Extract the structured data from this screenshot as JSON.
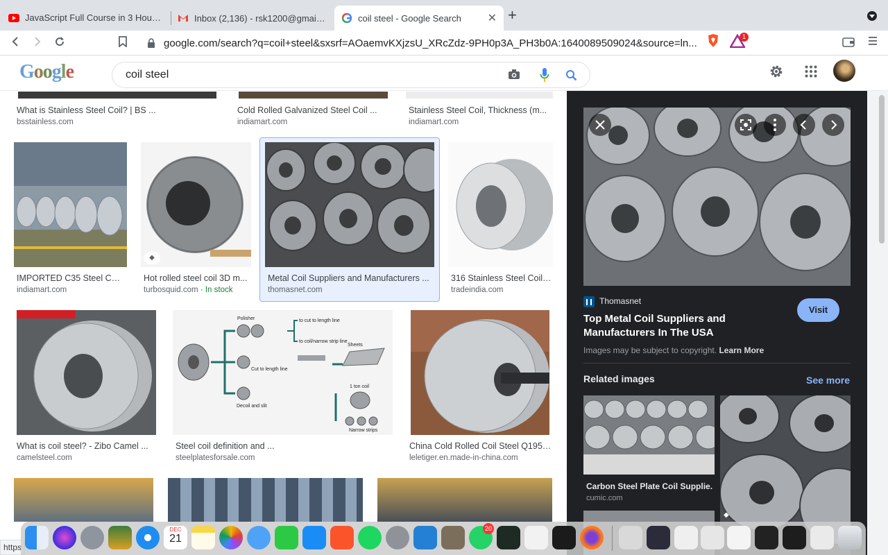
{
  "browser": {
    "tabs": [
      {
        "title": "JavaScript Full Course in 3 Hours 🔥",
        "icon": "youtube-icon"
      },
      {
        "title": "Inbox (2,136) - rsk1200@gmail.com",
        "icon": "gmail-icon"
      },
      {
        "title": "coil steel - Google Search",
        "icon": "google-icon",
        "active": true
      }
    ],
    "url": "google.com/search?q=coil+steel&sxsrf=AOaemvKXjzsU_XRcZdz-9PH0p3A_PH3b0A:1640089509024&source=ln...",
    "brave_badge": "1",
    "status_text": "https"
  },
  "search": {
    "query": "coil steel"
  },
  "results": [
    {
      "caption": "What is Stainless Steel Coil? | BS ...",
      "source": "bsstainless.com"
    },
    {
      "caption": "Cold Rolled Galvanized Steel Coil ...",
      "source": "indiamart.com"
    },
    {
      "caption": "Stainless Steel Coil, Thickness (m...",
      "source": "indiamart.com"
    },
    {
      "caption": "IMPORTED C35 Steel Coil, ...",
      "source": "indiamart.com"
    },
    {
      "caption": "Hot rolled steel coil 3D m...",
      "source": "turbosquid.com",
      "extra": " · In stock"
    },
    {
      "caption": "Metal Coil Suppliers and Manufacturers ...",
      "source": "thomasnet.com"
    },
    {
      "caption": "316 Stainless Steel Coil ...",
      "source": "tradeindia.com"
    },
    {
      "caption": "What is coil steel? - Zibo Camel ...",
      "source": "camelsteel.com"
    },
    {
      "caption": "Steel coil definition and ...",
      "source": "steelplatesforsale.com"
    },
    {
      "caption": "China Cold Rolled Coil Steel Q195 ...",
      "source": "leletiger.en.made-in-china.com"
    }
  ],
  "diagram_labels": {
    "polisher": "Polisher",
    "cut_to_length": "to cut to length line",
    "coil_narrow": "to coil/narrow strip line",
    "sheets": "Sheets",
    "cut_line": "Cut to length line",
    "ton_coil": "1 ton coil",
    "decoil": "Decoil and slit",
    "narrow": "Narrow strips"
  },
  "panel": {
    "site_name": "Thomasnet",
    "visit_label": "Visit",
    "title": "Top Metal Coil Suppliers and Manufacturers In The USA",
    "copyright": "Images may be subject to copyright.",
    "learn_more": "Learn More",
    "related_title": "Related images",
    "see_more": "See more",
    "related": [
      {
        "caption": "Carbon Steel Plate Coil Supplie...",
        "source": "cumic.com"
      }
    ]
  },
  "dock": {
    "calendar_month": "DEC",
    "calendar_day": "21",
    "whatsapp_badge": "20"
  },
  "colors": {
    "panel_bg": "#202124",
    "visit_button": "#8ab4f8",
    "selected_card": "#e8f0fe",
    "link_blue": "#8ab4f8"
  }
}
